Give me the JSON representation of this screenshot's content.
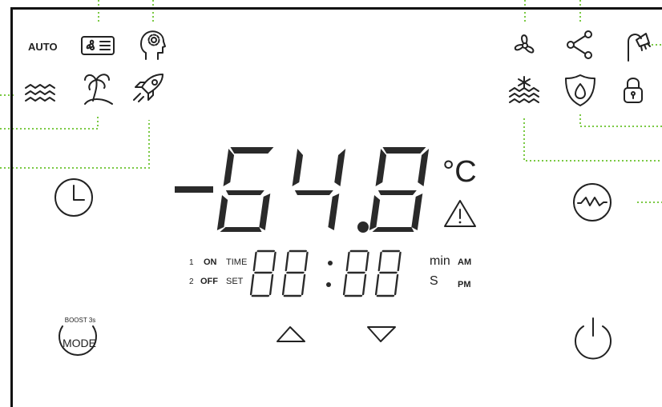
{
  "mode_label": "AUTO",
  "temperature": {
    "sign": "−",
    "digits": "64.8",
    "unit": "°C"
  },
  "timer": {
    "row1_index": "1",
    "row1_state": "ON",
    "row1_mode": "TIME",
    "row2_index": "2",
    "row2_state": "OFF",
    "row2_mode": "SET",
    "unit_min": "min",
    "unit_s": "S",
    "am": "AM",
    "pm": "PM"
  },
  "mode_button": {
    "top_label": "BOOST 3s",
    "label": "MODE"
  },
  "colors": {
    "leader_line": "#7ac943",
    "ink": "#222222",
    "panel_border": "#111111"
  },
  "icons": [
    "fan-card-icon",
    "head-settings-icon",
    "fan-icon",
    "share-icon",
    "shower-icon",
    "waves-icon",
    "island-icon",
    "rocket-icon",
    "snow-waves-icon",
    "water-shield-icon",
    "lock-icon",
    "clock-icon",
    "warning-icon",
    "sine-wave-icon",
    "power-icon",
    "up-arrow-icon",
    "down-arrow-icon"
  ]
}
